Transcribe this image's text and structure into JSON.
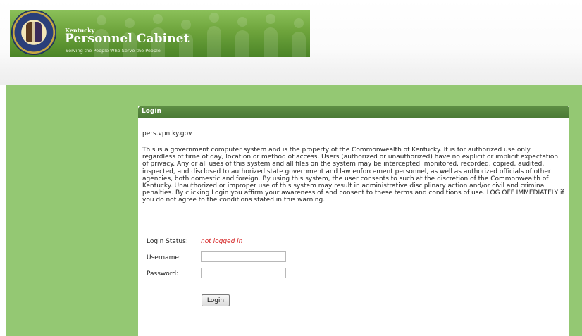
{
  "header": {
    "org_small": "Kentucky",
    "org_name": "Personnel Cabinet",
    "tagline": "Serving the People Who Serve the People"
  },
  "login_panel": {
    "title": "Login",
    "server": "pers.vpn.ky.gov",
    "warning": "This is a government computer system and is the property of the Commonwealth of Kentucky. It is for authorized use only regardless of time of day, location or method of access. Users (authorized or unauthorized) have no explicit or implicit expectation of privacy. Any or all uses of this system and all files on the system may be intercepted, monitored, recorded, copied, audited, inspected, and disclosed to authorized state government and law enforcement personnel, as well as authorized officials of other agencies, both domestic and foreign. By using this system, the user consents to such at the discretion of the Commonwealth of Kentucky. Unauthorized or improper use of this system may result in administrative disciplinary action and/or civil and criminal penalties. By clicking Login you affirm your awareness of and consent to these terms and conditions of use. LOG OFF IMMEDIATELY if you do not agree to the conditions stated in this warning.",
    "status_label": "Login Status:",
    "status_value": "not logged in",
    "username_label": "Username:",
    "username_value": "",
    "password_label": "Password:",
    "password_value": "",
    "login_button": "Login"
  },
  "colors": {
    "banner_green": "#6ea43c",
    "content_green": "#94c873",
    "panel_header": "#4b7a36",
    "status_red": "#d42020"
  }
}
